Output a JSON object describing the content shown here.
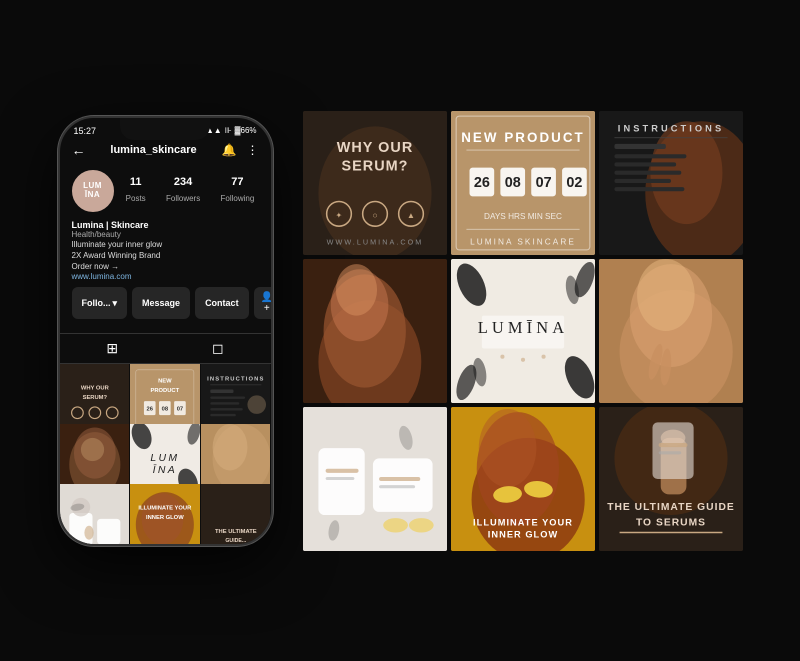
{
  "phone": {
    "status_time": "15:27",
    "signal": "📶",
    "battery": "66%",
    "username": "lumina_skincare",
    "bell_icon": "🔔",
    "menu_icon": "⋮",
    "back_icon": "←",
    "avatar_text": "LUM\nĪNA",
    "stats": [
      {
        "number": "11",
        "label": "Posts"
      },
      {
        "number": "234",
        "label": "Followers"
      },
      {
        "number": "77",
        "label": "Following"
      }
    ],
    "bio_name": "Lumina | Skincare",
    "bio_category": "Health/beauty",
    "bio_lines": [
      "Illuminate your inner glow",
      "2X Award Winning Brand",
      "Order now →"
    ],
    "bio_link": "www.lumina.com",
    "buttons": {
      "follow": "Follo...",
      "message": "Message",
      "contact": "Contact"
    }
  },
  "grid": {
    "items": [
      {
        "id": "why-serum",
        "bg": "#2a2220",
        "text": "WHY OUR SERUM?",
        "text_color": "#e8d5c4",
        "type": "text_skin"
      },
      {
        "id": "new-product",
        "bg": "#c9a882",
        "text": "NEW PRODUCT",
        "text_color": "#fff",
        "type": "product_skin"
      },
      {
        "id": "instructions",
        "bg": "#1a1a1a",
        "text": "INSTRUCTIONS",
        "text_color": "#ddd",
        "type": "instructions"
      },
      {
        "id": "model1",
        "bg": "#5a3a2a",
        "text": "",
        "type": "model_dark"
      },
      {
        "id": "lumina-logo",
        "bg": "#f5f0eb",
        "text": "LUMĪNA",
        "text_color": "#222",
        "type": "logo_light"
      },
      {
        "id": "model2",
        "bg": "#c8a882",
        "text": "",
        "type": "model_warm"
      },
      {
        "id": "product-flat",
        "bg": "#e8e4df",
        "text": "",
        "type": "product_flat"
      },
      {
        "id": "illuminate",
        "bg": "#c9950a",
        "text": "ILLUMINATE YOUR INNER GLOW",
        "text_color": "#fff",
        "type": "text_gold"
      },
      {
        "id": "ultimate-guide",
        "bg": "#2a2220",
        "text": "THE ULTIMATE GUIDE TO SERUMS",
        "text_color": "#e8d5c4",
        "type": "text_dark"
      }
    ]
  },
  "accent_color": "#c9a882",
  "brand_color": "#c9a89a"
}
